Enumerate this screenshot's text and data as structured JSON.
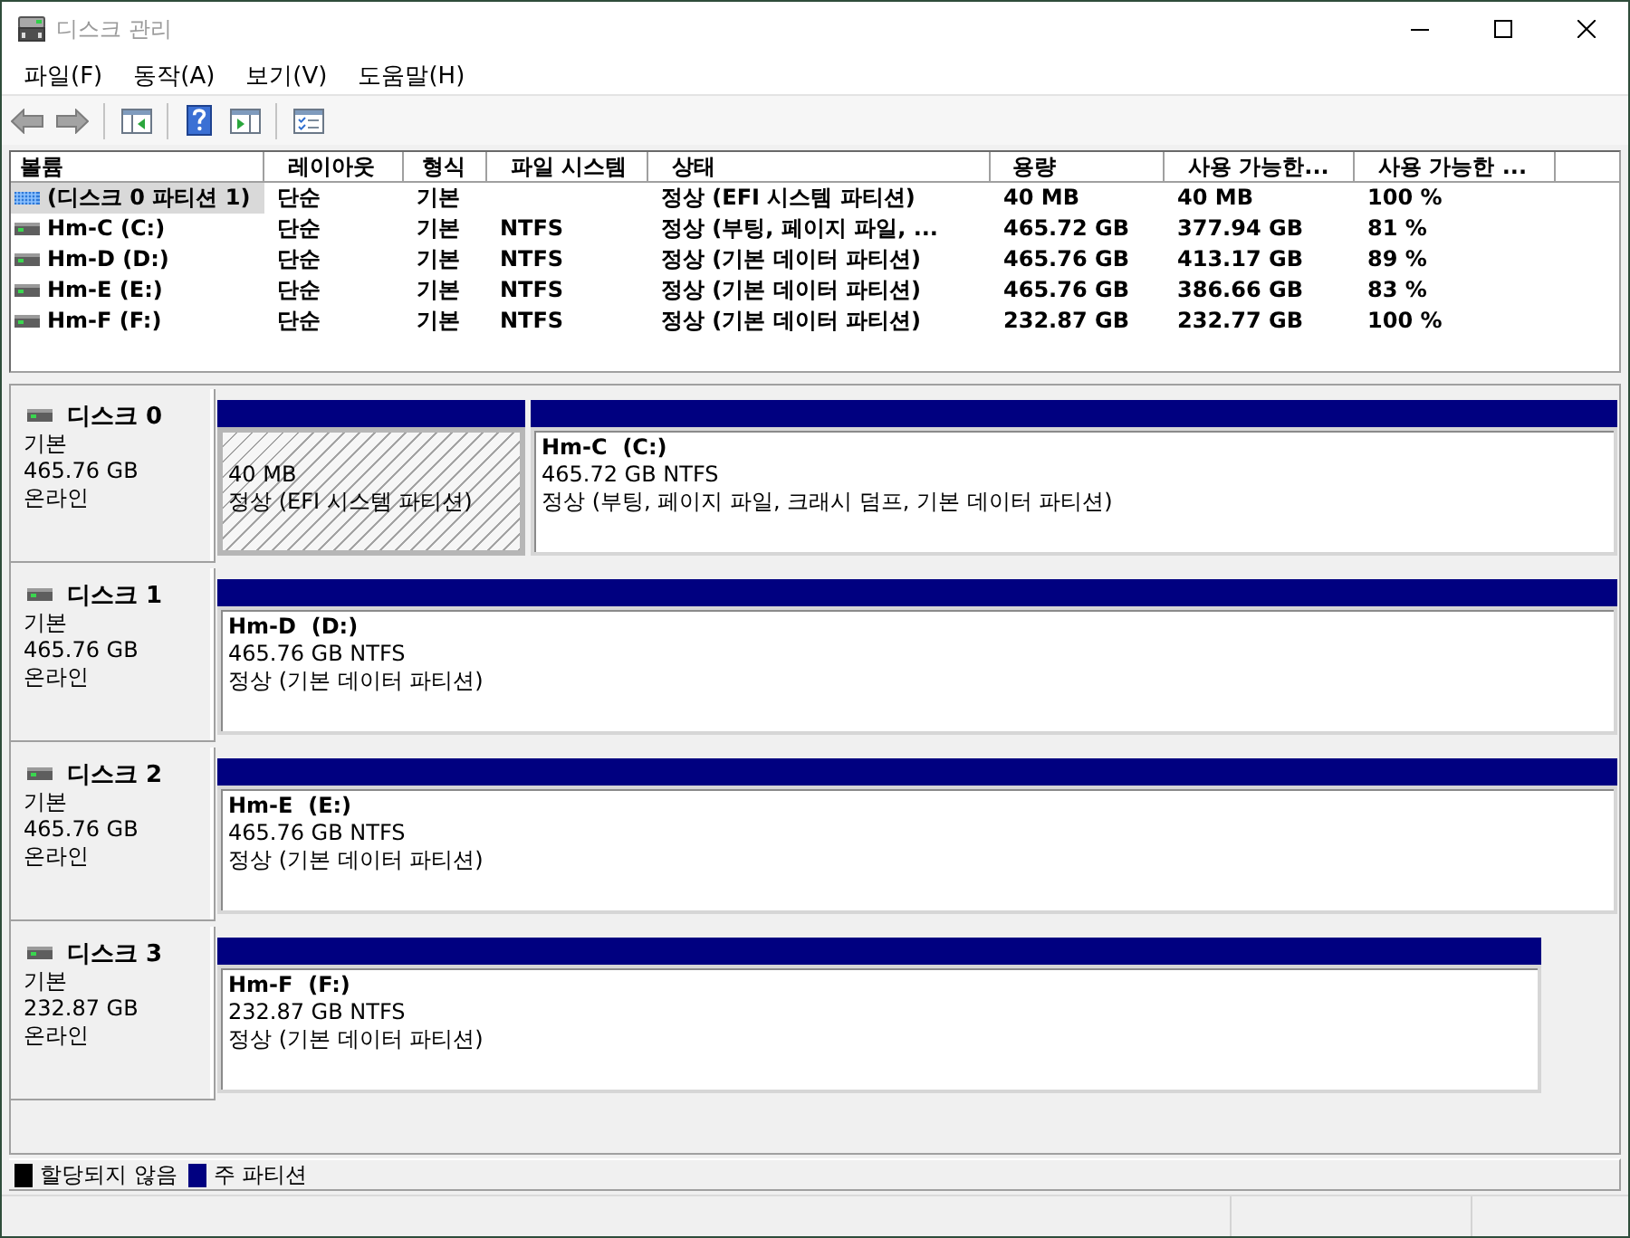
{
  "window": {
    "title": "디스크 관리"
  },
  "menu": [
    "파일(F)",
    "동작(A)",
    "보기(V)",
    "도움말(H)"
  ],
  "volume_list": {
    "columns": [
      "볼륨",
      "레이아웃",
      "형식",
      "파일 시스템",
      "상태",
      "용량",
      "사용 가능한...",
      "사용 가능한 ..."
    ],
    "rows": [
      {
        "kind": "partition",
        "selected": true,
        "volume": "(디스크 0 파티션 1)",
        "layout": "단순",
        "type": "기본",
        "status": "정상 (EFI 시스템 파티션)",
        "capacity": "40 MB",
        "column_7": "40 MB",
        "column_8": "100 %"
      },
      {
        "kind": "drive",
        "selected": false,
        "volume": "Hm-C (C:)",
        "layout": "단순",
        "type": "기본",
        "file_system": "NTFS",
        "status": "정상 (부팅, 페이지 파일, ...",
        "capacity": "465.72 GB",
        "column_7": "377.94 GB",
        "column_8": "81 %"
      },
      {
        "kind": "drive",
        "selected": false,
        "volume": "Hm-D (D:)",
        "layout": "단순",
        "type": "기본",
        "file_system": "NTFS",
        "status": "정상 (기본 데이터 파티션)",
        "capacity": "465.76 GB",
        "column_7": "413.17 GB",
        "column_8": "89 %"
      },
      {
        "kind": "drive",
        "selected": false,
        "volume": "Hm-E (E:)",
        "layout": "단순",
        "type": "기본",
        "file_system": "NTFS",
        "status": "정상 (기본 데이터 파티션)",
        "capacity": "465.76 GB",
        "column_7": "386.66 GB",
        "column_8": "83 %"
      },
      {
        "kind": "drive",
        "selected": false,
        "volume": "Hm-F (F:)",
        "layout": "단순",
        "type": "기본",
        "file_system": "NTFS",
        "status": "정상 (기본 데이터 파티션)",
        "capacity": "232.87 GB",
        "column_7": "232.77 GB",
        "column_8": "100 %"
      }
    ]
  },
  "disks": [
    {
      "name": "디스크 0",
      "type": "기본",
      "size": "465.76 GB",
      "status": "온라인",
      "partitions": [
        {
          "selected": true,
          "size": "40 MB",
          "status": "정상 (EFI 시스템 파티션)"
        },
        {
          "selected": false,
          "label": "Hm-C  (C:)",
          "size": "465.72 GB NTFS",
          "status": "정상 (부팅, 페이지 파일, 크래시 덤프, 기본 데이터 파티션)"
        }
      ]
    },
    {
      "name": "디스크 1",
      "type": "기본",
      "size": "465.76 GB",
      "status": "온라인",
      "partitions": [
        {
          "selected": false,
          "label": "Hm-D  (D:)",
          "size": "465.76 GB NTFS",
          "status": "정상 (기본 데이터 파티션)"
        }
      ]
    },
    {
      "name": "디스크 2",
      "type": "기본",
      "size": "465.76 GB",
      "status": "온라인",
      "partitions": [
        {
          "selected": false,
          "label": "Hm-E  (E:)",
          "size": "465.76 GB NTFS",
          "status": "정상 (기본 데이터 파티션)"
        }
      ]
    },
    {
      "name": "디스크 3",
      "type": "기본",
      "size": "232.87 GB",
      "status": "온라인",
      "partitions": [
        {
          "selected": false,
          "label": "Hm-F  (F:)",
          "size": "232.87 GB NTFS",
          "status": "정상 (기본 데이터 파티션)"
        }
      ]
    }
  ],
  "legend": [
    {
      "label": "할당되지 않음",
      "color": "#000000"
    },
    {
      "label": "주 파티션",
      "color": "#000080"
    }
  ]
}
